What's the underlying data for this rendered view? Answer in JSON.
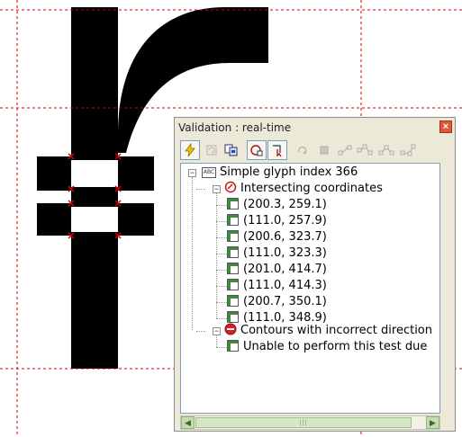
{
  "panel": {
    "title": "Validation : real-time",
    "close_label": "×"
  },
  "toolbar": {
    "buttons": [
      {
        "icon": "lightning-icon",
        "state": "pressed"
      },
      {
        "icon": "refresh-icon",
        "state": "disabled"
      },
      {
        "icon": "copy-icon",
        "state": "normal"
      },
      {
        "icon": "validate-glyph-icon",
        "state": "pressed"
      },
      {
        "icon": "select-point-icon",
        "state": "pressed"
      },
      {
        "icon": "rotate-icon",
        "state": "disabled"
      },
      {
        "icon": "square-icon",
        "state": "disabled"
      },
      {
        "icon": "node-graph-icon",
        "state": "disabled"
      },
      {
        "icon": "node-chain-icon",
        "state": "disabled"
      },
      {
        "icon": "node-tree-icon",
        "state": "disabled"
      },
      {
        "icon": "node-branch-icon",
        "state": "disabled"
      }
    ]
  },
  "tree": {
    "root": {
      "label": "Simple glyph index 366",
      "icon": "abc-glyph-icon"
    },
    "groups": [
      {
        "label": "Intersecting coordinates",
        "icon": "intersection-warning-icon",
        "items": [
          "(200.3, 259.1)",
          "(111.0, 257.9)",
          "(200.6, 323.7)",
          "(111.0, 323.3)",
          "(201.0, 414.7)",
          "(111.0, 414.3)",
          "(200.7, 350.1)",
          "(111.0, 348.9)"
        ]
      },
      {
        "label": "Contours with incorrect direction",
        "icon": "stop-error-icon",
        "items": [
          "Unable to perform this test due"
        ]
      }
    ]
  },
  "glyph": {
    "character": "r with double stroke",
    "fill_color": "#000000",
    "guide_color": "#d40000",
    "point_marker_color": "#d40000"
  }
}
